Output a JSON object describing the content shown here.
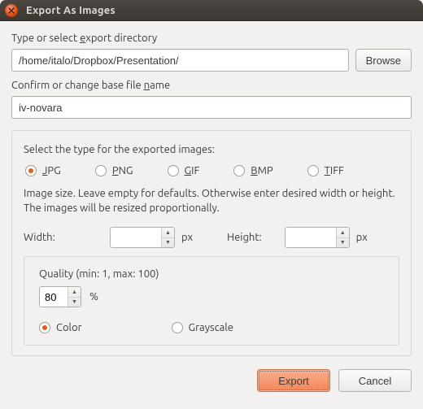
{
  "window": {
    "title": "Export As Images"
  },
  "dir": {
    "label_pre": "Type or select ",
    "label_key": "e",
    "label_post": "xport directory",
    "value": "/home/italo/Dropbox/Presentation/",
    "browse": "Browse"
  },
  "base": {
    "label_pre": "Confirm or change base file ",
    "label_key": "n",
    "label_post": "ame",
    "value": "iv-novara"
  },
  "types": {
    "label": "Select the type for the exported images:",
    "options": [
      {
        "key": "J",
        "rest": "PG",
        "selected": true
      },
      {
        "key": "P",
        "rest": "NG",
        "selected": false
      },
      {
        "key": "G",
        "rest": "IF",
        "selected": false
      },
      {
        "key": "B",
        "rest": "MP",
        "selected": false
      },
      {
        "key": "T",
        "rest": "IFF",
        "selected": false
      }
    ],
    "hint": "Image size. Leave empty for defaults. Otherwise enter desired width or height. The images will be resized proportionally."
  },
  "size": {
    "width_label": "Width:",
    "width_value": "",
    "height_label": "Height:",
    "height_value": "",
    "px": "px"
  },
  "quality": {
    "label": "Quality (min: 1, max: 100)",
    "value": "80",
    "pct": "%",
    "color": "Color",
    "grayscale": "Grayscale",
    "color_selected": true
  },
  "footer": {
    "export": "Export",
    "cancel": "Cancel"
  }
}
